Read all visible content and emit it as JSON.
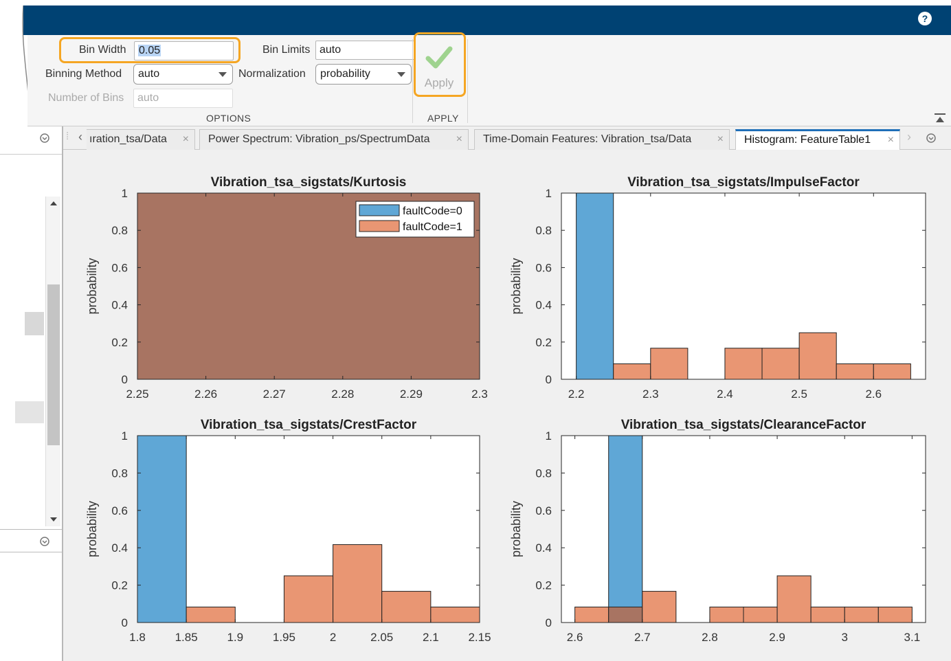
{
  "window": {
    "help_icon": "question-icon"
  },
  "toolstrip": {
    "bin_width_label": "Bin Width",
    "bin_width_value": "0.05",
    "bin_limits_label": "Bin Limits",
    "bin_limits_value": "auto",
    "binning_method_label": "Binning Method",
    "binning_method_value": "auto",
    "normalization_label": "Normalization",
    "normalization_value": "probability",
    "num_bins_label": "Number of Bins",
    "num_bins_value": "auto",
    "options_section": "OPTIONS",
    "apply_label": "Apply",
    "apply_section": "APPLY",
    "highlight_color": "#F5A623"
  },
  "tabs": [
    {
      "label": "ıration_tsa/Data",
      "active": false
    },
    {
      "label": "Power Spectrum: Vibration_ps/SpectrumData",
      "active": false
    },
    {
      "label": "Time-Domain Features: Vibration_tsa/Data",
      "active": false
    },
    {
      "label": "Histogram: FeatureTable1",
      "active": true
    }
  ],
  "colors": {
    "titlebar": "#004273",
    "fault0": "#5FA7D6",
    "fault1": "#E99673",
    "overlap": "#A87462",
    "tab_accent": "#1F6FB8"
  },
  "chart_data": [
    {
      "type": "bar",
      "title": "Vibration_tsa_sigstats/Kurtosis",
      "ylabel": "probability",
      "xlim": [
        2.25,
        2.3
      ],
      "ylim": [
        0,
        1
      ],
      "xticks": [
        "2.25",
        "2.26",
        "2.27",
        "2.28",
        "2.29",
        "2.3"
      ],
      "yticks": [
        "0",
        "0.2",
        "0.4",
        "0.6",
        "0.8",
        "1"
      ],
      "bin_width": 0.05,
      "legend": {
        "location": "top-right",
        "entries": [
          "faultCode=0",
          "faultCode=1"
        ]
      },
      "series": [
        {
          "name": "faultCode=0",
          "bins": [
            {
              "x0": 2.25,
              "x1": 2.3,
              "y": 1
            }
          ]
        },
        {
          "name": "faultCode=1",
          "bins": [
            {
              "x0": 2.25,
              "x1": 2.3,
              "y": 1
            }
          ]
        }
      ]
    },
    {
      "type": "bar",
      "title": "Vibration_tsa_sigstats/ImpulseFactor",
      "ylabel": "probability",
      "xlim": [
        2.18,
        2.67
      ],
      "ylim": [
        0,
        1
      ],
      "xticks": [
        "2.2",
        "2.3",
        "2.4",
        "2.5",
        "2.6"
      ],
      "yticks": [
        "0",
        "0.2",
        "0.4",
        "0.6",
        "0.8",
        "1"
      ],
      "bin_width": 0.05,
      "series": [
        {
          "name": "faultCode=0",
          "bins": [
            {
              "x0": 2.2,
              "x1": 2.25,
              "y": 1
            }
          ]
        },
        {
          "name": "faultCode=1",
          "bins": [
            {
              "x0": 2.25,
              "x1": 2.3,
              "y": 0.083
            },
            {
              "x0": 2.3,
              "x1": 2.35,
              "y": 0.167
            },
            {
              "x0": 2.4,
              "x1": 2.45,
              "y": 0.167
            },
            {
              "x0": 2.45,
              "x1": 2.5,
              "y": 0.167
            },
            {
              "x0": 2.5,
              "x1": 2.55,
              "y": 0.25
            },
            {
              "x0": 2.55,
              "x1": 2.6,
              "y": 0.083
            },
            {
              "x0": 2.6,
              "x1": 2.65,
              "y": 0.083
            }
          ]
        }
      ]
    },
    {
      "type": "bar",
      "title": "Vibration_tsa_sigstats/CrestFactor",
      "ylabel": "probability",
      "xlim": [
        1.8,
        2.15
      ],
      "ylim": [
        0,
        1
      ],
      "xticks": [
        "1.8",
        "1.85",
        "1.9",
        "1.95",
        "2",
        "2.05",
        "2.1",
        "2.15"
      ],
      "yticks": [
        "0",
        "0.2",
        "0.4",
        "0.6",
        "0.8",
        "1"
      ],
      "bin_width": 0.05,
      "series": [
        {
          "name": "faultCode=0",
          "bins": [
            {
              "x0": 1.8,
              "x1": 1.85,
              "y": 1
            }
          ]
        },
        {
          "name": "faultCode=1",
          "bins": [
            {
              "x0": 1.85,
              "x1": 1.9,
              "y": 0.083
            },
            {
              "x0": 1.95,
              "x1": 2.0,
              "y": 0.25
            },
            {
              "x0": 2.0,
              "x1": 2.05,
              "y": 0.417
            },
            {
              "x0": 2.05,
              "x1": 2.1,
              "y": 0.167
            },
            {
              "x0": 2.1,
              "x1": 2.15,
              "y": 0.083
            }
          ]
        }
      ]
    },
    {
      "type": "bar",
      "title": "Vibration_tsa_sigstats/ClearanceFactor",
      "ylabel": "probability",
      "xlim": [
        2.58,
        3.12
      ],
      "ylim": [
        0,
        1
      ],
      "xticks": [
        "2.6",
        "2.7",
        "2.8",
        "2.9",
        "3",
        "3.1"
      ],
      "yticks": [
        "0",
        "0.2",
        "0.4",
        "0.6",
        "0.8",
        "1"
      ],
      "bin_width": 0.05,
      "series": [
        {
          "name": "faultCode=0",
          "bins": [
            {
              "x0": 2.65,
              "x1": 2.7,
              "y": 1
            }
          ]
        },
        {
          "name": "faultCode=1",
          "bins": [
            {
              "x0": 2.6,
              "x1": 2.65,
              "y": 0.083
            },
            {
              "x0": 2.65,
              "x1": 2.7,
              "y": 0.083
            },
            {
              "x0": 2.7,
              "x1": 2.75,
              "y": 0.167
            },
            {
              "x0": 2.8,
              "x1": 2.85,
              "y": 0.083
            },
            {
              "x0": 2.85,
              "x1": 2.9,
              "y": 0.083
            },
            {
              "x0": 2.9,
              "x1": 2.95,
              "y": 0.25
            },
            {
              "x0": 2.95,
              "x1": 3.0,
              "y": 0.083
            },
            {
              "x0": 3.0,
              "x1": 3.05,
              "y": 0.083
            },
            {
              "x0": 3.05,
              "x1": 3.1,
              "y": 0.083
            }
          ]
        }
      ]
    }
  ]
}
